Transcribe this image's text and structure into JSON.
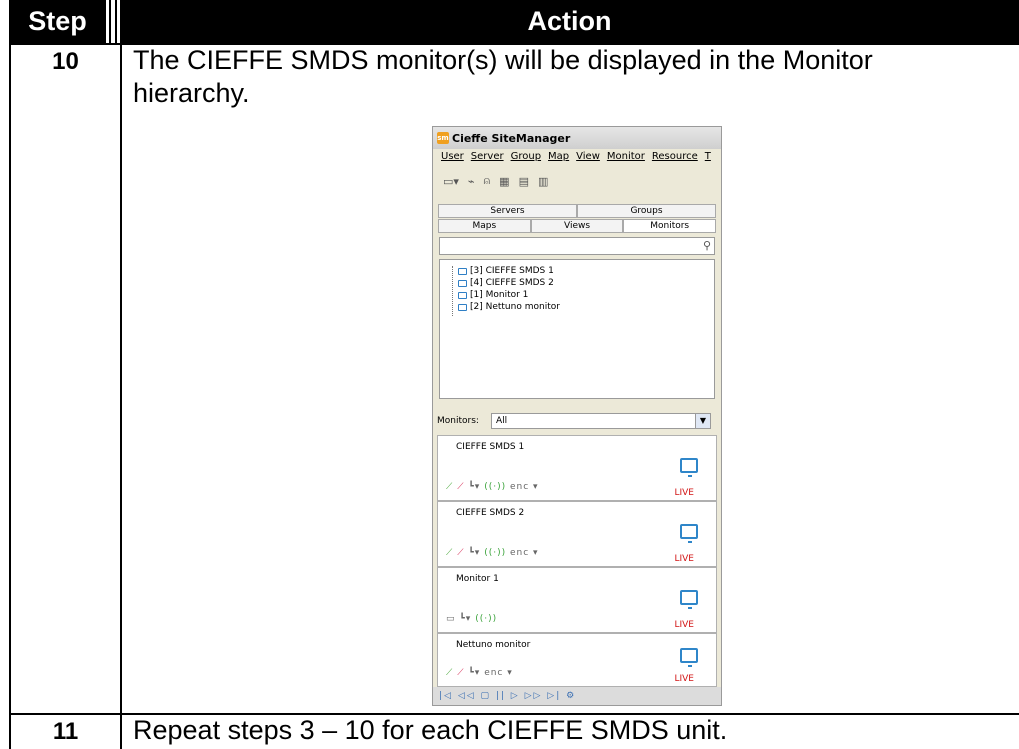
{
  "table": {
    "header": {
      "step": "Step",
      "action": "Action"
    },
    "rows": [
      {
        "step": "10",
        "action_line1": "The CIEFFE SMDS monitor(s) will be displayed in the Monitor",
        "action_line2": "hierarchy."
      },
      {
        "step": "11",
        "action_line1": "Repeat steps 3 – 10 for each CIEFFE SMDS unit."
      }
    ]
  },
  "screenshot": {
    "app_icon_text": "sm",
    "title": "Cieffe SiteManager",
    "menu": [
      "User",
      "Server",
      "Group",
      "Map",
      "View",
      "Monitor",
      "Resource",
      "T"
    ],
    "toolbar_icons": [
      "monitor-dropdown-icon",
      "pin-icon",
      "bell-icon",
      "layout-icons"
    ],
    "tabs_top": [
      "Servers",
      "Groups"
    ],
    "tabs_bottom": [
      "Maps",
      "Views",
      "Monitors"
    ],
    "active_tab": "Monitors",
    "search_placeholder": "",
    "tree": [
      "[3] CIEFFE SMDS 1",
      "[4] CIEFFE SMDS 2",
      "[1] Monitor 1",
      "[2] Nettuno monitor"
    ],
    "filter_label": "Monitors:",
    "filter_value": "All",
    "monitors": [
      {
        "name": "CIEFFE SMDS 1",
        "status": "LIVE",
        "controls": "⟋ ⟋ ┗▾ ((·)) enc ▾"
      },
      {
        "name": "CIEFFE SMDS 2",
        "status": "LIVE",
        "controls": "⟋ ⟋ ┗▾ ((·)) enc ▾"
      },
      {
        "name": "Monitor 1",
        "status": "LIVE",
        "controls": "▭ ┗▾ ((·))"
      },
      {
        "name": "Nettuno monitor",
        "status": "LIVE",
        "controls": "⟋ ⟋ ┗▾ enc ▾"
      }
    ],
    "playback_controls": "|◁ ◁◁ ▢ || ▷ ▷▷ ▷| ⚙"
  }
}
